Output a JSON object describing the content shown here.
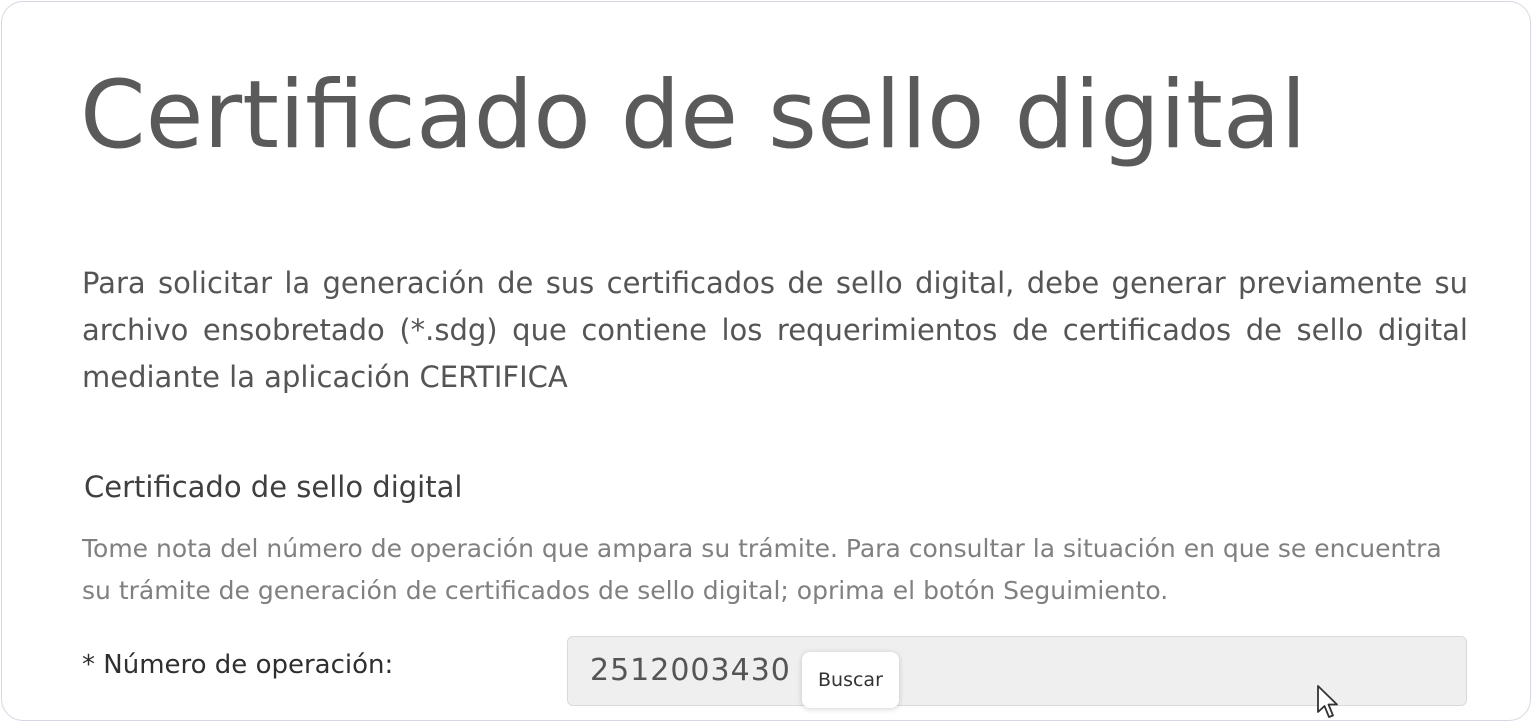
{
  "page": {
    "title": "Certificado de sello digital",
    "intro": "Para solicitar la generación de sus certificados de sello digital, debe generar previamente su archivo ensobretado (*.sdg) que contiene los requerimientos de certificados de sello digital mediante la aplicación CERTIFICA"
  },
  "section": {
    "heading": "Certificado de sello digital",
    "note": "Tome nota del número de operación que ampara su trámite. Para consultar la situación en que se encuentra su trámite de generación de certificados de sello digital; oprima el botón Seguimiento."
  },
  "form": {
    "operation_label": "* Número de operación:",
    "operation_value": "2512003430"
  },
  "tooltip": {
    "text": "Buscar"
  },
  "icons": {
    "cursor": "mouse-pointer-icon"
  }
}
